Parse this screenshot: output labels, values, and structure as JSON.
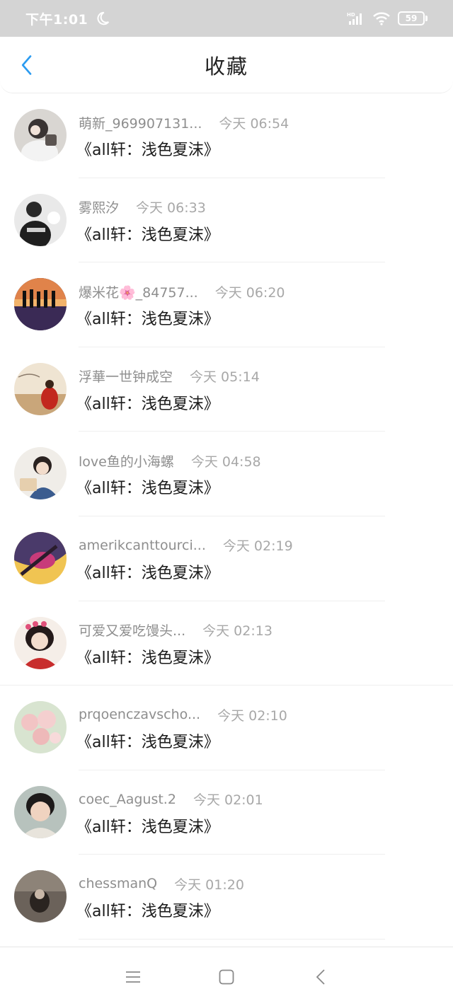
{
  "status_bar": {
    "time": "下午1:01",
    "battery": "59",
    "icons": [
      "moon-icon",
      "signal-icon",
      "wifi-icon",
      "battery-icon"
    ]
  },
  "header": {
    "title": "收藏",
    "back_icon": "chevron-left-icon",
    "accent": "#2b9bf0"
  },
  "items": [
    {
      "name": "萌新_969907131...",
      "time": "今天 06:54",
      "title": "《all轩：浅色夏沫》"
    },
    {
      "name": "雾熙汐",
      "time": "今天 06:33",
      "title": "《all轩：浅色夏沫》"
    },
    {
      "name": "爆米花🌸_84757...",
      "time": "今天 06:20",
      "title": "《all轩：浅色夏沫》"
    },
    {
      "name": "浮華一世钟成空",
      "time": "今天 05:14",
      "title": "《all轩：浅色夏沫》"
    },
    {
      "name": "love鱼的小海螺",
      "time": "今天 04:58",
      "title": "《all轩：浅色夏沫》"
    },
    {
      "name": "amerikcanttourci...",
      "time": "今天 02:19",
      "title": "《all轩：浅色夏沫》"
    },
    {
      "name": "可爱又爱吃馒头...",
      "time": "今天 02:13",
      "title": "《all轩：浅色夏沫》"
    },
    {
      "name": "prqoenczavscho...",
      "time": "今天 02:10",
      "title": "《all轩：浅色夏沫》"
    },
    {
      "name": "coec_Aagust.2",
      "time": "今天 02:01",
      "title": "《all轩：浅色夏沫》"
    },
    {
      "name": "chessmanQ",
      "time": "今天 01:20",
      "title": "《all轩：浅色夏沫》"
    }
  ],
  "nav_bar": {
    "icons": [
      "menu-icon",
      "home-square-icon",
      "back-triangle-icon"
    ]
  }
}
